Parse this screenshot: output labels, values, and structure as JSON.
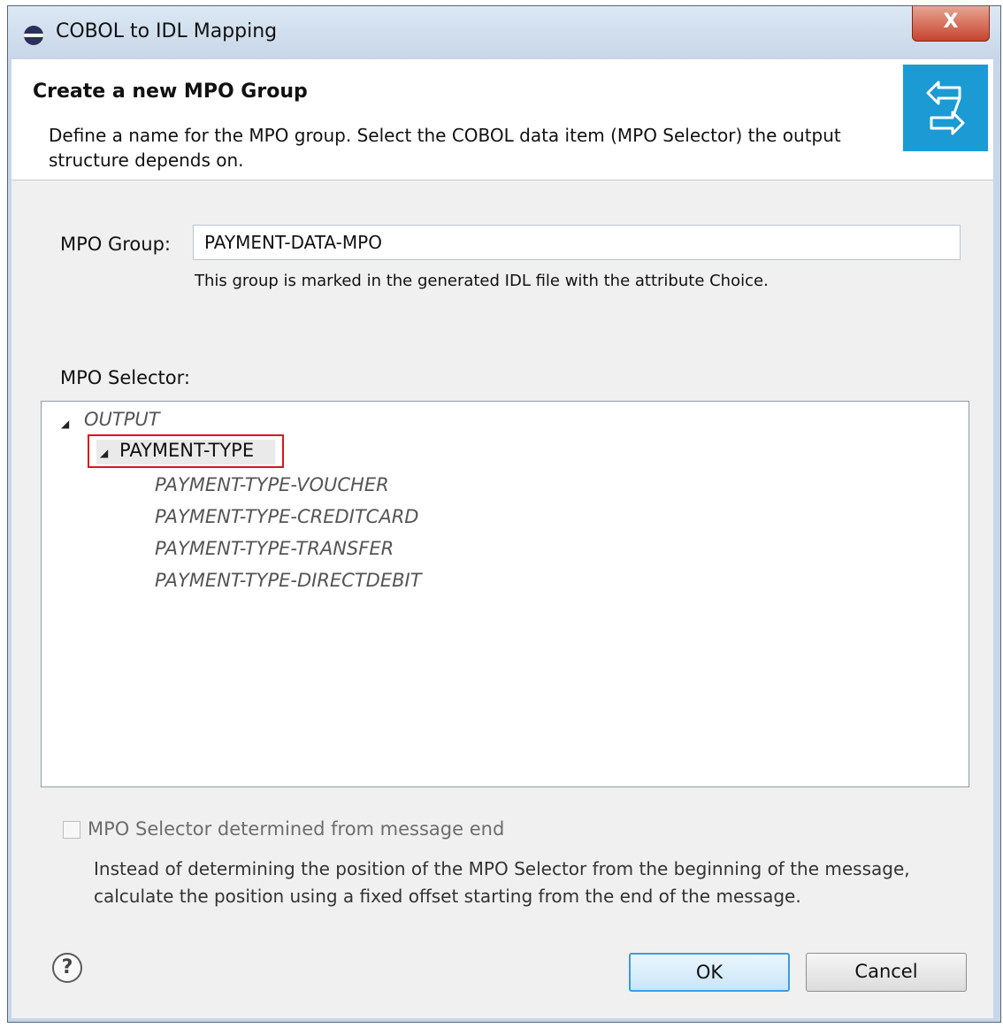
{
  "window": {
    "title": "COBOL to IDL Mapping",
    "close_label": "X"
  },
  "banner": {
    "title": "Create a new MPO Group",
    "description": "Define a name for the MPO group. Select the COBOL data item (MPO Selector) the output structure depends on."
  },
  "mpo_group": {
    "label": "MPO Group:",
    "value": "PAYMENT-DATA-MPO",
    "hint": "This group is marked in the generated IDL file with the attribute Choice."
  },
  "mpo_selector": {
    "label": "MPO Selector:",
    "root": "OUTPUT",
    "selected": "PAYMENT-TYPE",
    "children": [
      "PAYMENT-TYPE-VOUCHER",
      "PAYMENT-TYPE-CREDITCARD",
      "PAYMENT-TYPE-TRANSFER",
      "PAYMENT-TYPE-DIRECTDEBIT"
    ]
  },
  "checkbox": {
    "label": "MPO Selector determined from message end",
    "checked": false,
    "description": "Instead of determining the position of the MPO Selector from the beginning of the message, calculate the position using a fixed offset starting from the end of the message."
  },
  "buttons": {
    "ok": "OK",
    "cancel": "Cancel",
    "help": "?"
  },
  "colors": {
    "banner_accent": "#1b9ad4",
    "selection_border": "#d9161e",
    "ok_border": "#3c9be0"
  }
}
